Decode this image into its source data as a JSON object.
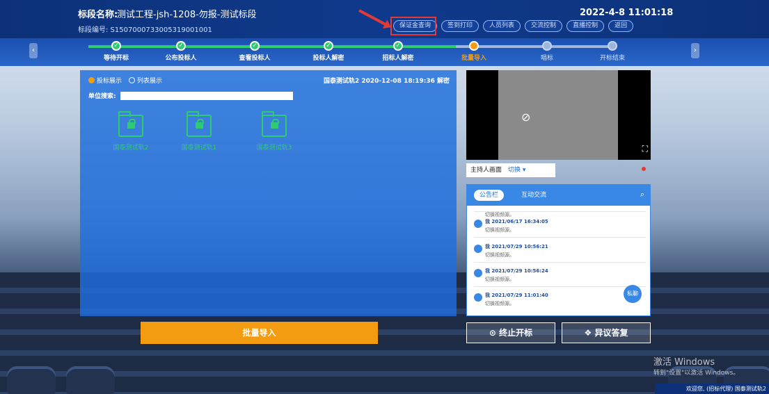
{
  "header": {
    "name_label": "标段名称:",
    "name_value": "测试工程-jsh-1208-勿报-测试标段",
    "code": "标段编号: S1507000733005319001001",
    "datetime": "2022-4-8  11:01:18",
    "buttons": [
      "保证金查询",
      "签到打印",
      "人员列表",
      "交流控制",
      "直播控制",
      "返回"
    ]
  },
  "steps": [
    {
      "label": "等待开标",
      "state": "done"
    },
    {
      "label": "公布投标人",
      "state": "done"
    },
    {
      "label": "查看投标人",
      "state": "done"
    },
    {
      "label": "投标人解密",
      "state": "done"
    },
    {
      "label": "招标人解密",
      "state": "done"
    },
    {
      "label": "批量导入",
      "state": "current"
    },
    {
      "label": "唱标",
      "state": "todo"
    },
    {
      "label": "开标结束",
      "state": "todo"
    }
  ],
  "panel": {
    "radio_bid": "投标展示",
    "radio_list": "列表展示",
    "open_info": "国泰测试轨2 2020-12-08 18:19:36 解密",
    "search_label": "单位搜索:",
    "folders": [
      "国泰测试轨2",
      "国泰测试轨1",
      "国泰测试轨3"
    ],
    "batch_label": "批量导入"
  },
  "side": {
    "host_label": "主持人画面",
    "switch_label": "切换",
    "tab_notice": "公告栏",
    "tab_chat": "互动交流",
    "partial_msg": "切换视频源。",
    "messages": [
      {
        "head": "我 2021/06/17 16:34:05",
        "body": "切换视频源。"
      },
      {
        "head": "我 2021/07/29 10:56:21",
        "body": "切换视频源。"
      },
      {
        "head": "我 2021/07/29 10:56:24",
        "body": "切换视频源。"
      },
      {
        "head": "我 2021/07/29 11:01:40",
        "body": "切换视频源。"
      }
    ],
    "private_label": "私聊",
    "stop_label": "终止开标",
    "objection_label": "异议答复"
  },
  "watermark": {
    "line1": "激活 Windows",
    "line2": "转到\"设置\"以激活 Windows。"
  },
  "status_text": "欢迎您, (招标代理) 国泰测试轨2",
  "colors": {
    "accent": "#f39c12",
    "done": "#2ecc71",
    "primary": "#1f6fd4",
    "alert": "#e53935"
  }
}
